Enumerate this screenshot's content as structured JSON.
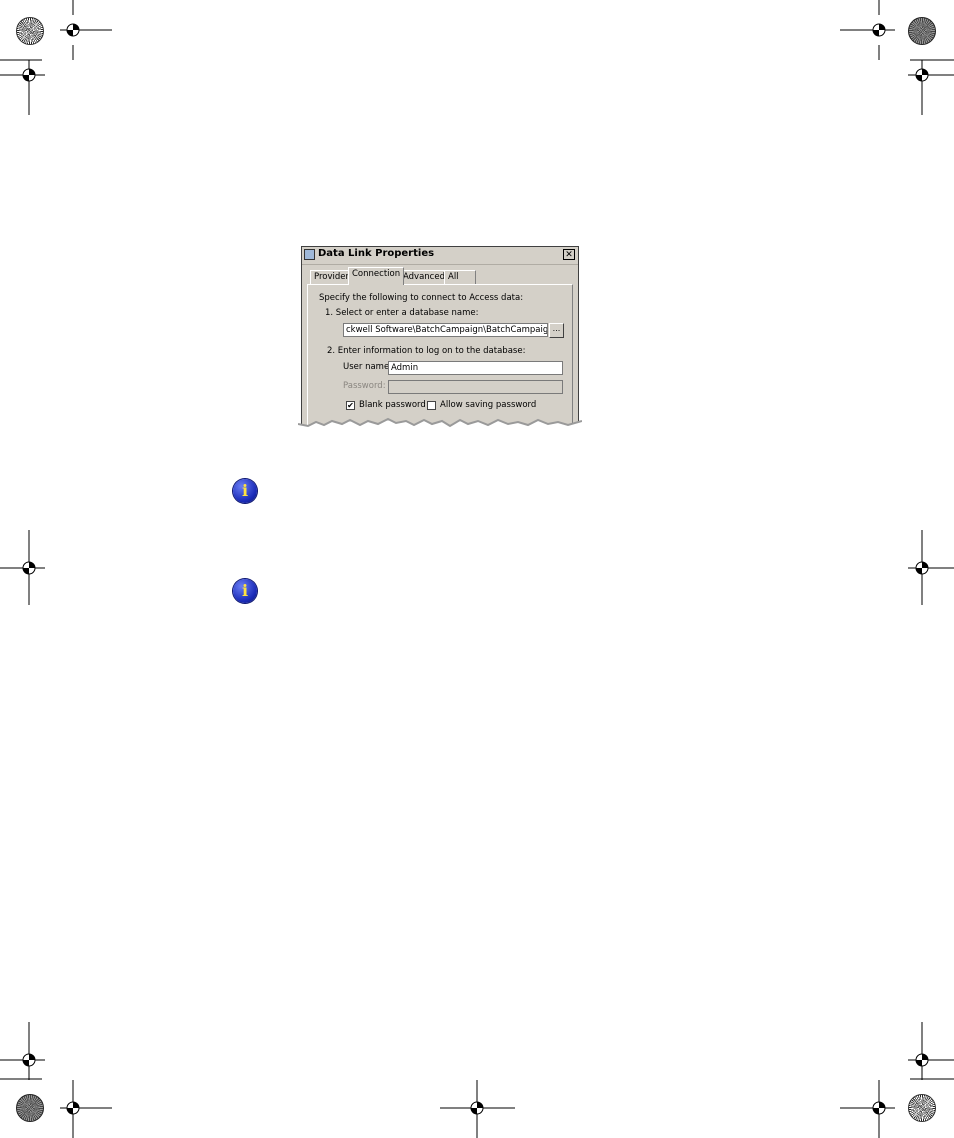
{
  "dialog": {
    "title": "Data Link Properties",
    "close_glyph": "✕",
    "tabs": [
      {
        "label": "Provider"
      },
      {
        "label": "Connection"
      },
      {
        "label": "Advanced"
      },
      {
        "label": "All"
      }
    ],
    "active_tab": "Connection",
    "intro": "Specify the following to connect to Access data:",
    "step1_label": "1. Select or enter a database name:",
    "database_path": "ckwell Software\\BatchCampaign\\BatchCampaign.mdb",
    "browse_label": "...",
    "step2_label": "2. Enter information to log on to the database:",
    "username_label": "User name:",
    "username_value": "Admin",
    "password_label": "Password:",
    "password_value": "",
    "blank_password_label": "Blank password",
    "blank_password_checked": true,
    "allow_saving_label": "Allow saving password",
    "allow_saving_checked": false
  },
  "icons": [
    "info-icon",
    "info-icon",
    "registration-mark-icon",
    "spiral-mark-icon"
  ]
}
